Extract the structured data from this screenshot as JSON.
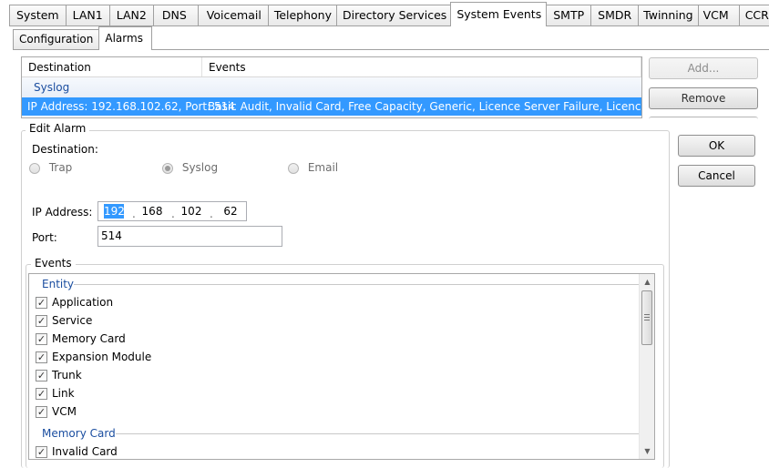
{
  "top_tabs": [
    "System",
    "LAN1",
    "LAN2",
    "DNS",
    "Voicemail",
    "Telephony",
    "Directory Services",
    "System Events",
    "SMTP",
    "SMDR",
    "Twinning",
    "VCM",
    "CCR"
  ],
  "sub_tabs": [
    "Configuration",
    "Alarms"
  ],
  "alarm_list": {
    "columns": [
      "Destination",
      "Events"
    ],
    "group": "Syslog",
    "row": {
      "destination": "IP Address: 192.168.102.62, Port: 514",
      "events": "Basic Audit, Invalid Card, Free Capacity, Generic, Licence Server Failure, Licence Key Failure"
    }
  },
  "side_buttons": {
    "add": "Add...",
    "remove": "Remove"
  },
  "dialog_buttons": {
    "ok": "OK",
    "cancel": "Cancel"
  },
  "edit_alarm": {
    "title": "Edit Alarm",
    "destination_label": "Destination:",
    "radios": {
      "trap": "Trap",
      "syslog": "Syslog",
      "email": "Email"
    },
    "selected_destination": "syslog",
    "ip_label": "IP Address:",
    "ip": [
      "192",
      "168",
      "102",
      "62"
    ],
    "port_label": "Port:",
    "port": "514"
  },
  "events": {
    "title": "Events",
    "groups": [
      {
        "name": "Entity",
        "items": [
          "Application",
          "Service",
          "Memory Card",
          "Expansion Module",
          "Trunk",
          "Link",
          "VCM"
        ]
      },
      {
        "name": "Memory Card",
        "items": [
          "Invalid Card"
        ]
      }
    ]
  }
}
